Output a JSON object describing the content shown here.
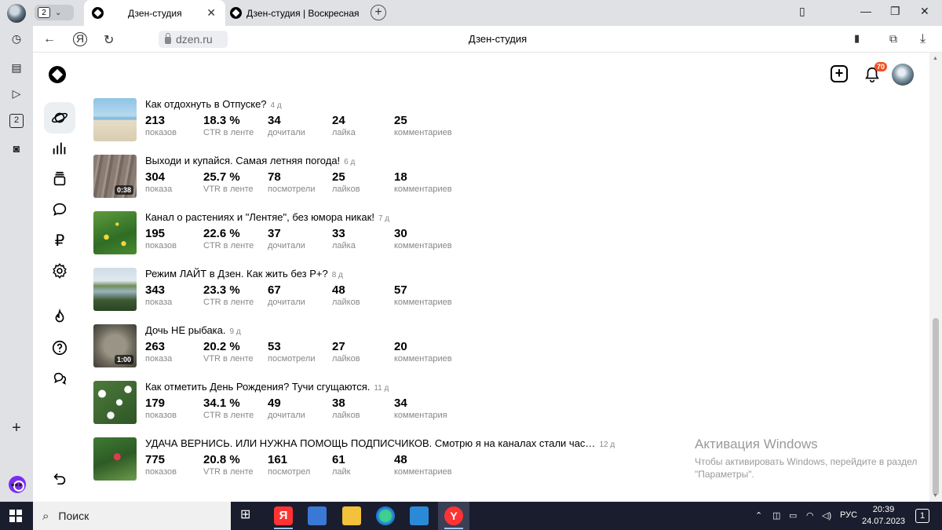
{
  "browser": {
    "tab_count": "2",
    "tabs": [
      {
        "label": "Дзен-студия"
      },
      {
        "label": "Дзен-студия | Воскресная"
      }
    ],
    "url": "dzen.ru",
    "page_title": "Дзен-студия"
  },
  "header": {
    "notifications_count": "70"
  },
  "sidebar": {
    "items": [
      {
        "icon": "planet-icon",
        "active": true
      },
      {
        "icon": "stats-icon"
      },
      {
        "icon": "publications-icon"
      },
      {
        "icon": "comments-icon"
      },
      {
        "icon": "ruble-icon"
      },
      {
        "icon": "settings-icon"
      },
      {
        "icon": "fire-icon"
      },
      {
        "icon": "help-icon"
      },
      {
        "icon": "chat-icon"
      },
      {
        "icon": "logout-icon"
      }
    ]
  },
  "publications": [
    {
      "title": "Как отдохнуть в Отпуске?",
      "age": "4 д",
      "thumb": "beach",
      "duration": "",
      "stats": [
        {
          "v": "213",
          "l": "показов"
        },
        {
          "v": "18.3 %",
          "l": "CTR в ленте"
        },
        {
          "v": "34",
          "l": "дочитали"
        },
        {
          "v": "24",
          "l": "лайка"
        },
        {
          "v": "25",
          "l": "комментариев"
        }
      ]
    },
    {
      "title": "Выходи и купайся. Самая летняя погода!",
      "age": "6 д",
      "thumb": "deck",
      "duration": "0:38",
      "stats": [
        {
          "v": "304",
          "l": "показа"
        },
        {
          "v": "25.7 %",
          "l": "VTR в ленте"
        },
        {
          "v": "78",
          "l": "посмотрели"
        },
        {
          "v": "25",
          "l": "лайков"
        },
        {
          "v": "18",
          "l": "комментариев"
        }
      ]
    },
    {
      "title": "Канал о растениях и \"Лентяе\", без юмора никак!",
      "age": "7 д",
      "thumb": "plants",
      "duration": "",
      "stats": [
        {
          "v": "195",
          "l": "показов"
        },
        {
          "v": "22.6 %",
          "l": "CTR в ленте"
        },
        {
          "v": "37",
          "l": "дочитали"
        },
        {
          "v": "33",
          "l": "лайка"
        },
        {
          "v": "30",
          "l": "комментариев"
        }
      ]
    },
    {
      "title": "Режим ЛАЙТ в Дзен. Как жить без Р+?",
      "age": "8 д",
      "thumb": "lake",
      "duration": "",
      "stats": [
        {
          "v": "343",
          "l": "показа"
        },
        {
          "v": "23.3 %",
          "l": "CTR в ленте"
        },
        {
          "v": "67",
          "l": "дочитали"
        },
        {
          "v": "48",
          "l": "лайков"
        },
        {
          "v": "57",
          "l": "комментариев"
        }
      ]
    },
    {
      "title": "Дочь НЕ рыбака.",
      "age": "9 д",
      "thumb": "fish",
      "duration": "1:00",
      "stats": [
        {
          "v": "263",
          "l": "показа"
        },
        {
          "v": "20.2 %",
          "l": "VTR в ленте"
        },
        {
          "v": "53",
          "l": "посмотрели"
        },
        {
          "v": "27",
          "l": "лайков"
        },
        {
          "v": "20",
          "l": "комментариев"
        }
      ]
    },
    {
      "title": "Как отметить День Рождения? Тучи сгущаются.",
      "age": "11 д",
      "thumb": "flowers",
      "duration": "",
      "stats": [
        {
          "v": "179",
          "l": "показов"
        },
        {
          "v": "34.1 %",
          "l": "CTR в ленте"
        },
        {
          "v": "49",
          "l": "дочитали"
        },
        {
          "v": "38",
          "l": "лайков"
        },
        {
          "v": "34",
          "l": "комментария"
        }
      ]
    },
    {
      "title": "УДАЧА ВЕРНИСЬ. ИЛИ НУЖНА ПОМОЩЬ ПОДПИСЧИКОВ. Смотрю я на каналах стали час…",
      "age": "12 д",
      "thumb": "garden",
      "duration": "",
      "stats": [
        {
          "v": "775",
          "l": "показов"
        },
        {
          "v": "20.8 %",
          "l": "VTR в ленте"
        },
        {
          "v": "161",
          "l": "посмотрел"
        },
        {
          "v": "61",
          "l": "лайк"
        },
        {
          "v": "48",
          "l": "комментариев"
        }
      ]
    }
  ],
  "watermark": {
    "heading": "Активация Windows",
    "text": "Чтобы активировать Windows, перейдите в раздел \"Параметры\"."
  },
  "taskbar": {
    "search_label": "Поиск",
    "language": "РУС",
    "time": "20:39",
    "date": "24.07.2023",
    "notif_count": "1"
  }
}
